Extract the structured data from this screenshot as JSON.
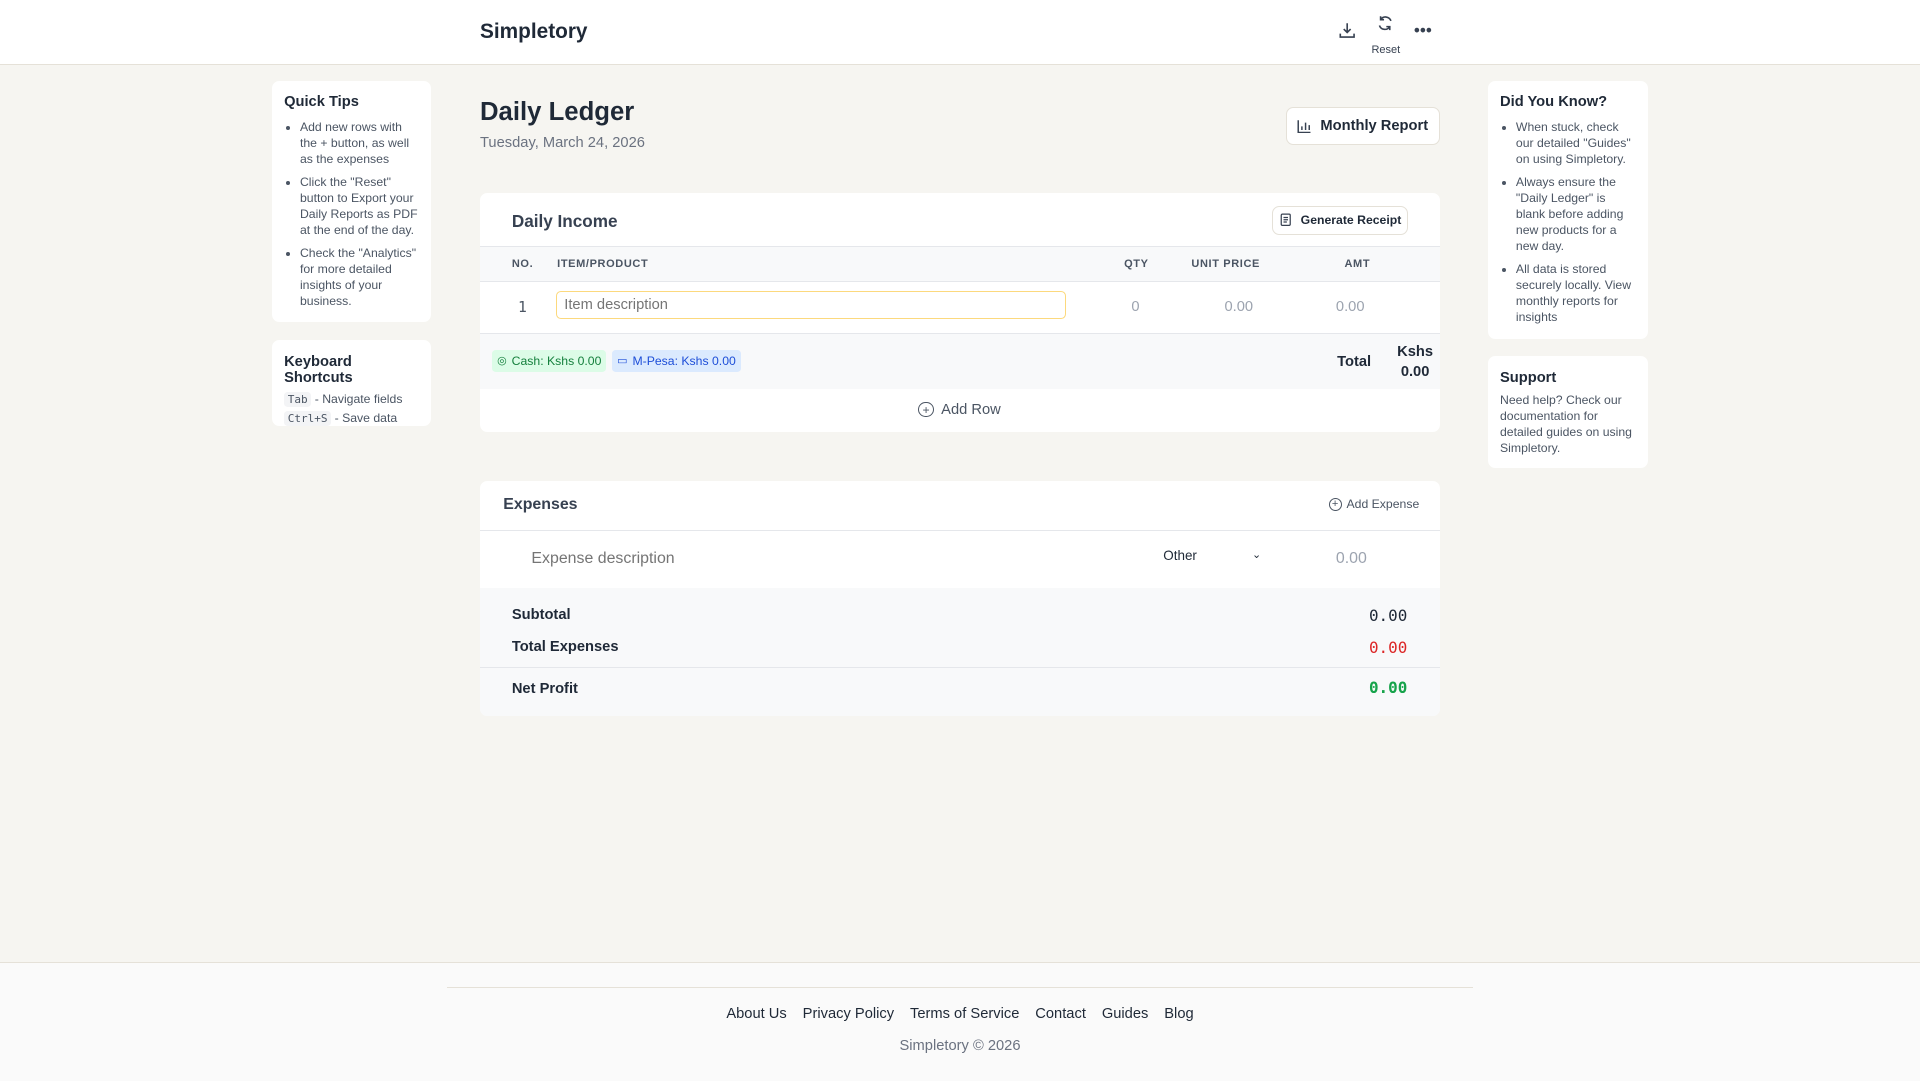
{
  "header": {
    "brand": "Simpletory",
    "reset_label": "Reset"
  },
  "page": {
    "title": "Daily Ledger",
    "date": "Tuesday, March 24, 2026",
    "monthly_report": "Monthly Report"
  },
  "quick_tips": {
    "title": "Quick Tips",
    "items": [
      "Add new rows with the + button, as well as the expenses",
      "Click the \"Reset\" button to Export your Daily Reports as PDF at the end of the day.",
      "Check the \"Analytics\" for more detailed insights of your business."
    ]
  },
  "shortcuts": {
    "title": "Keyboard Shortcuts",
    "items": [
      {
        "key": "Tab",
        "desc": "- Navigate fields"
      },
      {
        "key": "Ctrl+S",
        "desc": "- Save data"
      }
    ]
  },
  "income": {
    "title": "Daily Income",
    "generate_receipt": "Generate Receipt",
    "columns": [
      "NO.",
      "ITEM/PRODUCT",
      "QTY",
      "UNIT PRICE",
      "AMT"
    ],
    "rows": [
      {
        "no": "1",
        "item_placeholder": "Item description",
        "qty": "0",
        "unit_price": "0.00",
        "amt": "0.00"
      }
    ],
    "cash": "Cash: Kshs 0.00",
    "mpesa": "M-Pesa: Kshs 0.00",
    "total_label": "Total",
    "total_currency": "Kshs",
    "total_value": "0.00",
    "add_row": "Add Row"
  },
  "expenses": {
    "title": "Expenses",
    "add_expense": "Add Expense",
    "row": {
      "placeholder": "Expense description",
      "category": "Other",
      "amount": "0.00"
    },
    "subtotal_label": "Subtotal",
    "subtotal": "0.00",
    "total_label": "Total Expenses",
    "total": "0.00",
    "net_label": "Net Profit",
    "net": "0.00"
  },
  "did_you_know": {
    "title": "Did You Know?",
    "items": [
      "When stuck, check our detailed \"Guides\" on using Simpletory.",
      "Always ensure the \"Daily Ledger\" is blank before adding new products for a new day.",
      "All data is stored securely locally. View monthly reports for insights"
    ]
  },
  "support": {
    "title": "Support",
    "text": "Need help? Check our documentation for detailed guides on using Simpletory."
  },
  "footer": {
    "links": [
      "About Us",
      "Privacy Policy",
      "Terms of Service",
      "Contact",
      "Guides",
      "Blog"
    ],
    "copyright": "Simpletory © 2026"
  },
  "colors": {
    "bg": "#f6f5f1",
    "red": "#dc2626",
    "green": "#16a34a",
    "cash_bg": "#dcfce7",
    "mpesa_bg": "#dbeafe"
  }
}
